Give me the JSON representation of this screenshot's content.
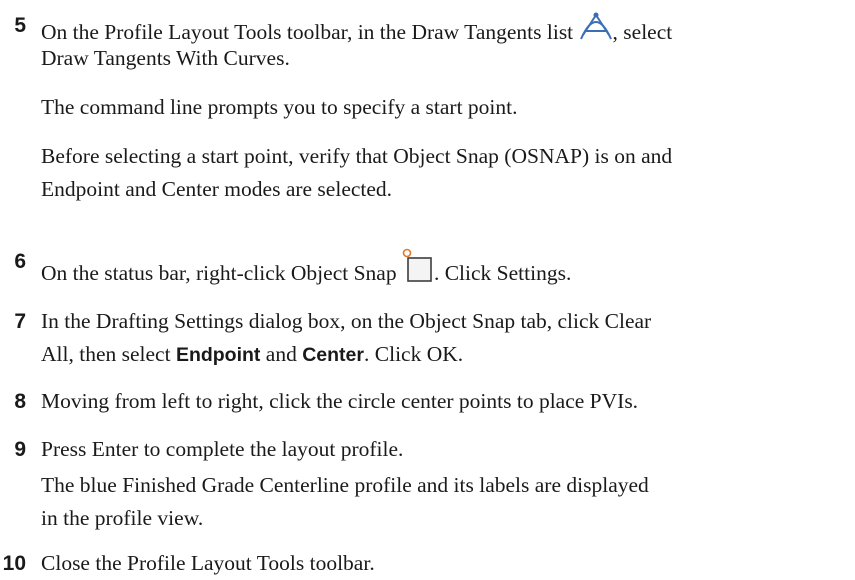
{
  "steps": [
    {
      "number": "5",
      "line1_before": "On the Profile Layout Tools toolbar, in the Draw Tangents list",
      "line1_after": ", select",
      "line2": "Draw Tangents With Curves.",
      "icon": "draw-tangents-icon",
      "notes": [
        "The command line prompts you to specify a start point.",
        "Before selecting a start point, verify that Object Snap (OSNAP) is on and",
        "Endpoint and Center modes are selected."
      ]
    },
    {
      "number": "6",
      "text_before": "On the status bar, right-click Object Snap",
      "text_after": ". Click Settings.",
      "icon": "object-snap-icon"
    },
    {
      "number": "7",
      "line1": "In the Drafting Settings dialog box, on the Object Snap tab, click Clear",
      "line2_a": "All, then select ",
      "line2_bold1": "Endpoint",
      "line2_b": " and ",
      "line2_bold2": "Center",
      "line2_c": ". Click OK."
    },
    {
      "number": "8",
      "text": "Moving from left to right, click the circle center points to place PVIs."
    },
    {
      "number": "9",
      "text": "Press Enter to complete the layout profile.",
      "notes": [
        "The blue Finished Grade Centerline profile and its labels are displayed",
        "in the profile view."
      ]
    },
    {
      "number": "10",
      "text": "Close the Profile Layout Tools toolbar."
    }
  ]
}
